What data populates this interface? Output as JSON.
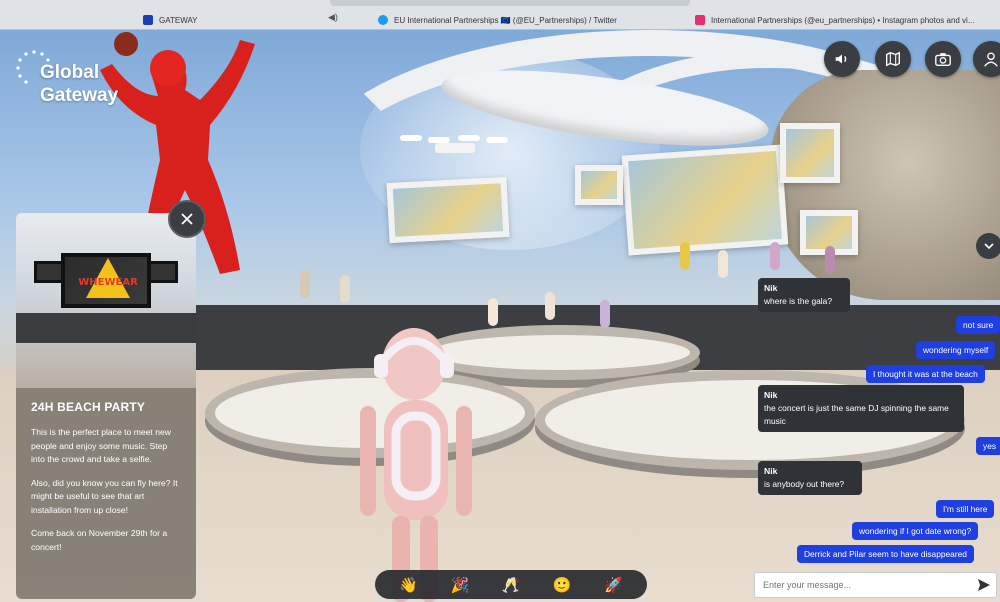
{
  "browser": {
    "tabs": [
      {
        "label": "GATEWAY",
        "favicon_color": "#1a3fb0"
      },
      {
        "label": "EU International Partnerships 🇪🇺 (@EU_Partnerships) / Twitter",
        "favicon_color": "#1d9bf0"
      },
      {
        "label": "International Partnerships (@eu_partnerships) • Instagram photos and vi...",
        "favicon_color": "#e1306c"
      }
    ]
  },
  "logo": {
    "line1": "Global",
    "line2": "Gateway"
  },
  "controls": [
    {
      "name": "sound",
      "icon": "speaker-icon"
    },
    {
      "name": "map",
      "icon": "map-icon"
    },
    {
      "name": "camera",
      "icon": "camera-icon"
    },
    {
      "name": "profile",
      "icon": "user-icon"
    }
  ],
  "info_panel": {
    "thumb_text": "WHEWEAR",
    "title": "24H BEACH PARTY",
    "paragraphs": [
      "This is the perfect place to meet new people and enjoy some music. Step into the crowd and take a selfie.",
      "Also, did you know you can fly here? It might be useful to see that art installation from up close!",
      "Come back on November 29th for a concert!"
    ]
  },
  "chat": {
    "messages": [
      {
        "from": "Nik",
        "text": "where is the gala?",
        "own": false
      },
      {
        "text": "not sure",
        "own": true
      },
      {
        "text": "wondering myself",
        "own": true
      },
      {
        "text": "I thought it was at the beach",
        "own": true
      },
      {
        "from": "Nik",
        "text": "the concert is just the same DJ spinning the same music",
        "own": false
      },
      {
        "text": "yes",
        "own": true
      },
      {
        "from": "Nik",
        "text": "is anybody out there?",
        "own": false
      },
      {
        "text": "I'm still here",
        "own": true
      },
      {
        "text": "wondering if I got date wrong?",
        "own": true
      },
      {
        "text": "Derrick and Pilar seem to have disappeared",
        "own": true
      }
    ],
    "input_placeholder": "Enter your message..."
  },
  "emotes": [
    {
      "glyph": "👋",
      "name": "wave-emote"
    },
    {
      "glyph": "🎉",
      "name": "party-emote"
    },
    {
      "glyph": "🥂",
      "name": "cheers-emote"
    },
    {
      "glyph": "🙂",
      "name": "smile-emote"
    },
    {
      "glyph": "🚀",
      "name": "rocket-emote"
    }
  ],
  "colors": {
    "own_bubble": "#1f3fe0",
    "other_bubble": "#2f3236",
    "panel": "#807970",
    "accent_red": "#d8201c"
  }
}
